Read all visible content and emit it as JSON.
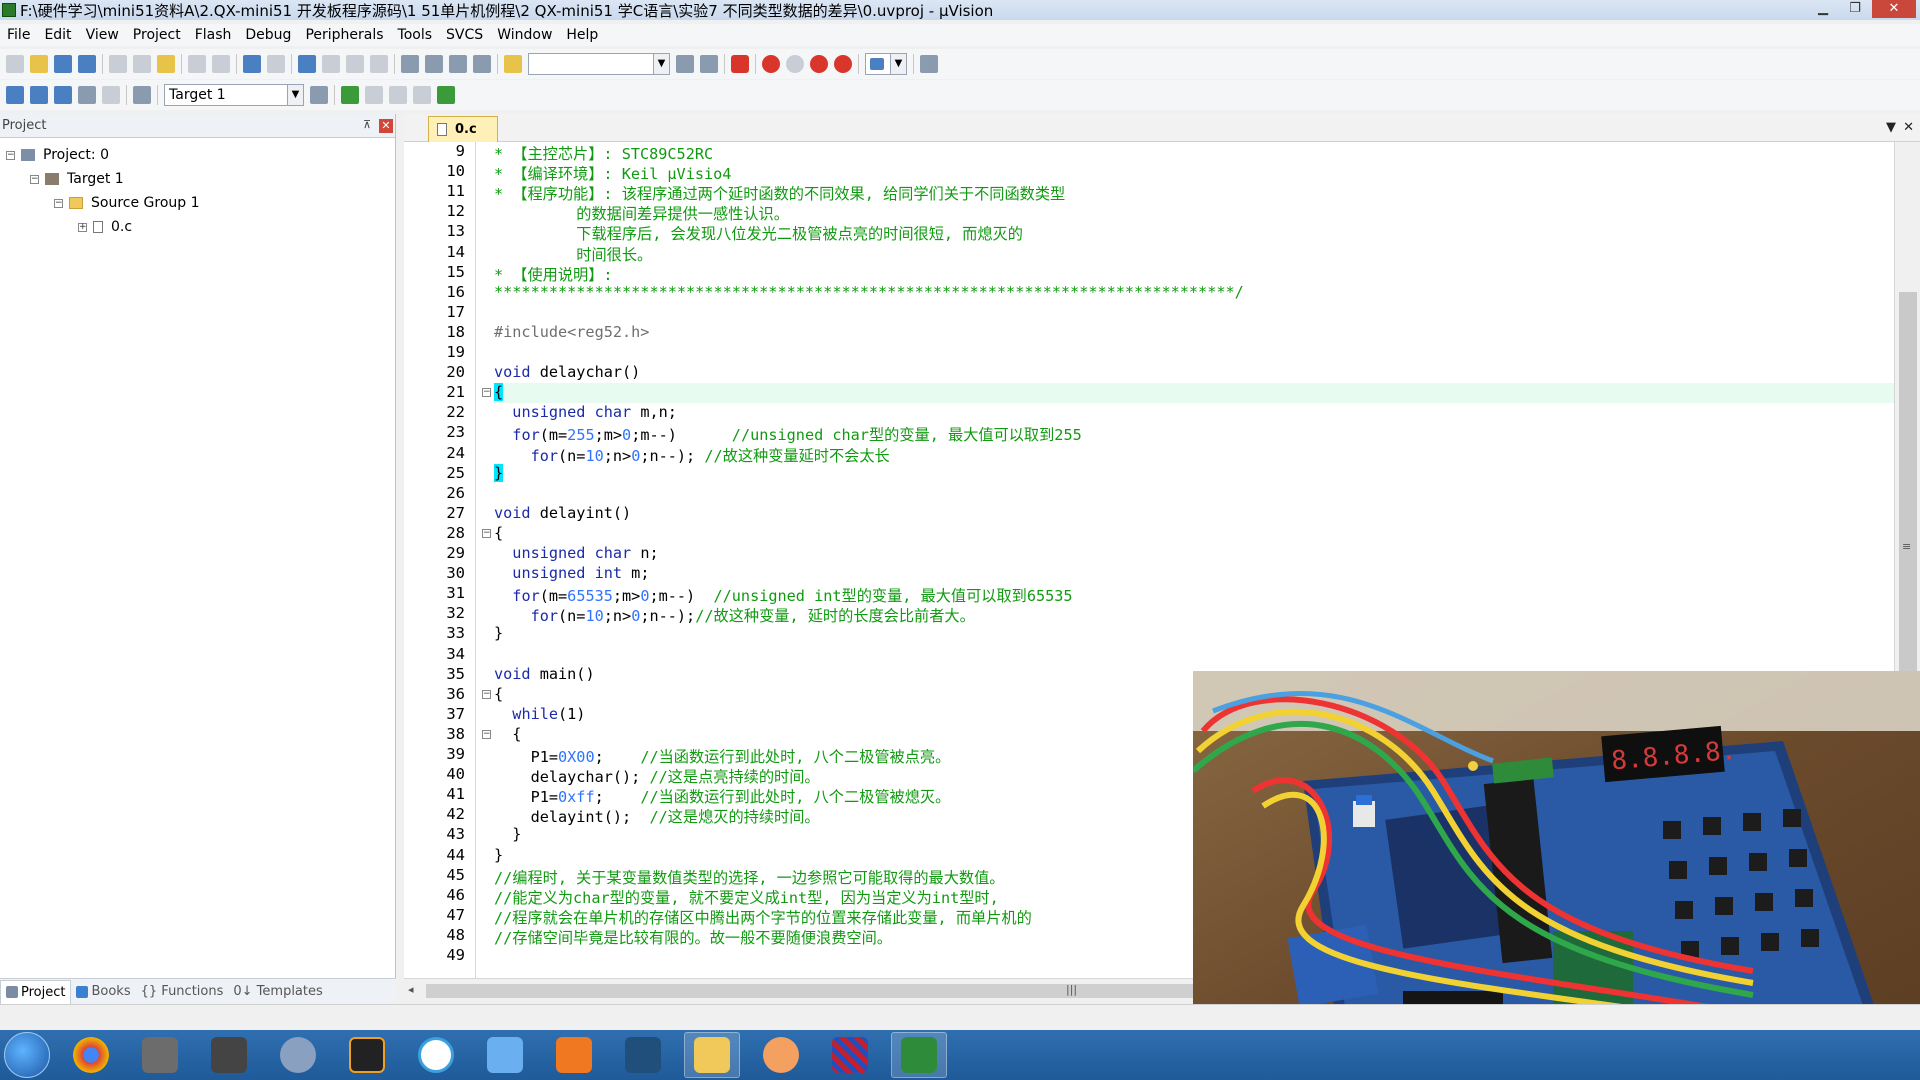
{
  "window": {
    "title": "F:\\硬件学习\\mini51资料A\\2.QX-mini51 开发板程序源码\\1 51单片机例程\\2 QX-mini51 学C语言\\实验7 不同类型数据的差异\\0.uvproj - µVision",
    "min_icon": "minimize-icon",
    "max_icon": "maximize-icon",
    "close_icon": "close-icon",
    "min_glyph": "▁",
    "max_glyph": "❐",
    "close_glyph": "✕"
  },
  "menu": [
    "File",
    "Edit",
    "View",
    "Project",
    "Flash",
    "Debug",
    "Peripherals",
    "Tools",
    "SVCS",
    "Window",
    "Help"
  ],
  "toolbar": {
    "find_combo_value": "",
    "target_combo_value": "Target 1"
  },
  "project_panel": {
    "title": "Project",
    "pin_glyph": "⊼",
    "close_glyph": "✕",
    "tree": [
      {
        "label": "Project: 0",
        "toggle": "−",
        "icon": "project-icon"
      },
      {
        "label": "Target 1",
        "toggle": "−",
        "icon": "target-icon"
      },
      {
        "label": "Source Group 1",
        "toggle": "−",
        "icon": "folder-icon"
      },
      {
        "label": "0.c",
        "toggle": "+",
        "icon": "c-file-icon"
      }
    ],
    "tabs": [
      "Project",
      "Books",
      "{} Functions",
      "0↓ Templates"
    ]
  },
  "editor": {
    "tab_label": "0.c",
    "tab_menu_glyph": "▼",
    "tab_close_glyph": "✕",
    "lines": [
      {
        "n": "9",
        "segs": [
          {
            "t": "* 【主控芯片】: STC89C52RC",
            "c": "cm"
          }
        ]
      },
      {
        "n": "10",
        "segs": [
          {
            "t": "* 【编译环境】: Keil µVisio4",
            "c": "cm"
          }
        ]
      },
      {
        "n": "11",
        "segs": [
          {
            "t": "* 【程序功能】: 该程序通过两个延时函数的不同效果, 给同学们关于不同函数类型",
            "c": "cm"
          }
        ]
      },
      {
        "n": "12",
        "segs": [
          {
            "t": "         的数据间差异提供一感性认识。",
            "c": "cm"
          }
        ]
      },
      {
        "n": "13",
        "segs": [
          {
            "t": "         下载程序后, 会发现八位发光二极管被点亮的时间很短, 而熄灭的",
            "c": "cm"
          }
        ]
      },
      {
        "n": "14",
        "segs": [
          {
            "t": "         时间很长。",
            "c": "cm"
          }
        ]
      },
      {
        "n": "15",
        "segs": [
          {
            "t": "* 【使用说明】:",
            "c": "cm"
          }
        ]
      },
      {
        "n": "16",
        "segs": [
          {
            "t": "*********************************************************************************/",
            "c": "cm"
          }
        ]
      },
      {
        "n": "17",
        "segs": []
      },
      {
        "n": "18",
        "segs": [
          {
            "t": "#include<reg52.h>",
            "c": "pp"
          }
        ]
      },
      {
        "n": "19",
        "segs": []
      },
      {
        "n": "20",
        "segs": [
          {
            "t": "void",
            "c": "kw"
          },
          {
            "t": " delaychar()",
            "c": ""
          }
        ]
      },
      {
        "n": "21",
        "fold": "−",
        "current": true,
        "segs": [
          {
            "t": "{",
            "c": "br"
          }
        ]
      },
      {
        "n": "22",
        "segs": [
          {
            "t": "  ",
            "c": ""
          },
          {
            "t": "unsigned char",
            "c": "kw"
          },
          {
            "t": " m,n;",
            "c": ""
          }
        ]
      },
      {
        "n": "23",
        "segs": [
          {
            "t": "  ",
            "c": ""
          },
          {
            "t": "for",
            "c": "kw"
          },
          {
            "t": "(m=",
            "c": ""
          },
          {
            "t": "255",
            "c": "num"
          },
          {
            "t": ";m>",
            "c": ""
          },
          {
            "t": "0",
            "c": "num"
          },
          {
            "t": ";m--)      ",
            "c": ""
          },
          {
            "t": "//unsigned char型的变量, 最大值可以取到255",
            "c": "cm"
          }
        ]
      },
      {
        "n": "24",
        "segs": [
          {
            "t": "    ",
            "c": ""
          },
          {
            "t": "for",
            "c": "kw"
          },
          {
            "t": "(n=",
            "c": ""
          },
          {
            "t": "10",
            "c": "num"
          },
          {
            "t": ";n>",
            "c": ""
          },
          {
            "t": "0",
            "c": "num"
          },
          {
            "t": ";n--); ",
            "c": ""
          },
          {
            "t": "//故这种变量延时不会太长",
            "c": "cm"
          }
        ]
      },
      {
        "n": "25",
        "segs": [
          {
            "t": "}",
            "c": "br"
          }
        ]
      },
      {
        "n": "26",
        "segs": []
      },
      {
        "n": "27",
        "segs": [
          {
            "t": "void",
            "c": "kw"
          },
          {
            "t": " delayint()",
            "c": ""
          }
        ]
      },
      {
        "n": "28",
        "fold": "−",
        "segs": [
          {
            "t": "{",
            "c": ""
          }
        ]
      },
      {
        "n": "29",
        "segs": [
          {
            "t": "  ",
            "c": ""
          },
          {
            "t": "unsigned char",
            "c": "kw"
          },
          {
            "t": " n;",
            "c": ""
          }
        ]
      },
      {
        "n": "30",
        "segs": [
          {
            "t": "  ",
            "c": ""
          },
          {
            "t": "unsigned int",
            "c": "kw"
          },
          {
            "t": " m;",
            "c": ""
          }
        ]
      },
      {
        "n": "31",
        "segs": [
          {
            "t": "  ",
            "c": ""
          },
          {
            "t": "for",
            "c": "kw"
          },
          {
            "t": "(m=",
            "c": ""
          },
          {
            "t": "65535",
            "c": "num"
          },
          {
            "t": ";m>",
            "c": ""
          },
          {
            "t": "0",
            "c": "num"
          },
          {
            "t": ";m--)  ",
            "c": ""
          },
          {
            "t": "//unsigned int型的变量, 最大值可以取到65535",
            "c": "cm"
          }
        ]
      },
      {
        "n": "32",
        "segs": [
          {
            "t": "    ",
            "c": ""
          },
          {
            "t": "for",
            "c": "kw"
          },
          {
            "t": "(n=",
            "c": ""
          },
          {
            "t": "10",
            "c": "num"
          },
          {
            "t": ";n>",
            "c": ""
          },
          {
            "t": "0",
            "c": "num"
          },
          {
            "t": ";n--);",
            "c": ""
          },
          {
            "t": "//故这种变量, 延时的长度会比前者大。",
            "c": "cm"
          }
        ]
      },
      {
        "n": "33",
        "segs": [
          {
            "t": "}",
            "c": ""
          }
        ]
      },
      {
        "n": "34",
        "segs": []
      },
      {
        "n": "35",
        "segs": [
          {
            "t": "void",
            "c": "kw"
          },
          {
            "t": " main()",
            "c": ""
          }
        ]
      },
      {
        "n": "36",
        "fold": "−",
        "segs": [
          {
            "t": "{",
            "c": ""
          }
        ]
      },
      {
        "n": "37",
        "segs": [
          {
            "t": "  ",
            "c": ""
          },
          {
            "t": "while",
            "c": "kw"
          },
          {
            "t": "(1)",
            "c": ""
          }
        ]
      },
      {
        "n": "38",
        "fold": "−",
        "segs": [
          {
            "t": "  {",
            "c": ""
          }
        ]
      },
      {
        "n": "39",
        "segs": [
          {
            "t": "    P1=",
            "c": ""
          },
          {
            "t": "0X00",
            "c": "num"
          },
          {
            "t": ";    ",
            "c": ""
          },
          {
            "t": "//当函数运行到此处时, 八个二极管被点亮。",
            "c": "cm"
          }
        ]
      },
      {
        "n": "40",
        "segs": [
          {
            "t": "    delaychar(); ",
            "c": ""
          },
          {
            "t": "//这是点亮持续的时间。",
            "c": "cm"
          }
        ]
      },
      {
        "n": "41",
        "segs": [
          {
            "t": "    P1=",
            "c": ""
          },
          {
            "t": "0xff",
            "c": "num"
          },
          {
            "t": ";    ",
            "c": ""
          },
          {
            "t": "//当函数运行到此处时, 八个二极管被熄灭。",
            "c": "cm"
          }
        ]
      },
      {
        "n": "42",
        "segs": [
          {
            "t": "    delayint();  ",
            "c": ""
          },
          {
            "t": "//这是熄灭的持续时间。",
            "c": "cm"
          }
        ]
      },
      {
        "n": "43",
        "segs": [
          {
            "t": "  }",
            "c": ""
          }
        ]
      },
      {
        "n": "44",
        "segs": [
          {
            "t": "}",
            "c": ""
          }
        ]
      },
      {
        "n": "45",
        "segs": [
          {
            "t": "//编程时, 关于某变量数值类型的选择, 一边参照它可能取得的最大数值。",
            "c": "cm"
          }
        ]
      },
      {
        "n": "46",
        "segs": [
          {
            "t": "//能定义为char型的变量, 就不要定义成int型, 因为当定义为int型时,",
            "c": "cm"
          }
        ]
      },
      {
        "n": "47",
        "segs": [
          {
            "t": "//程序就会在单片机的存储区中腾出两个字节的位置来存储此变量, 而单片机的",
            "c": "cm"
          }
        ]
      },
      {
        "n": "48",
        "segs": [
          {
            "t": "//存储空间毕竟是比较有限的。故一般不要随便浪费空间。",
            "c": "cm"
          }
        ]
      },
      {
        "n": "49",
        "segs": []
      }
    ]
  },
  "scrollbar": {
    "h_grip": "|||",
    "v_grip": "≡"
  },
  "overlay": {
    "display_digits": "8.8.8.8."
  },
  "taskbar": {
    "apps": [
      "chrome-icon",
      "video-editor-icon",
      "clapper-icon",
      "media-player-icon",
      "g-app-icon",
      "photos-icon",
      "bird-app-icon",
      "pdf-icon",
      "video-tool-icon",
      "file-explorer-icon",
      "fox-icon",
      "stripes-app-icon",
      "keil-uvision-icon"
    ]
  }
}
